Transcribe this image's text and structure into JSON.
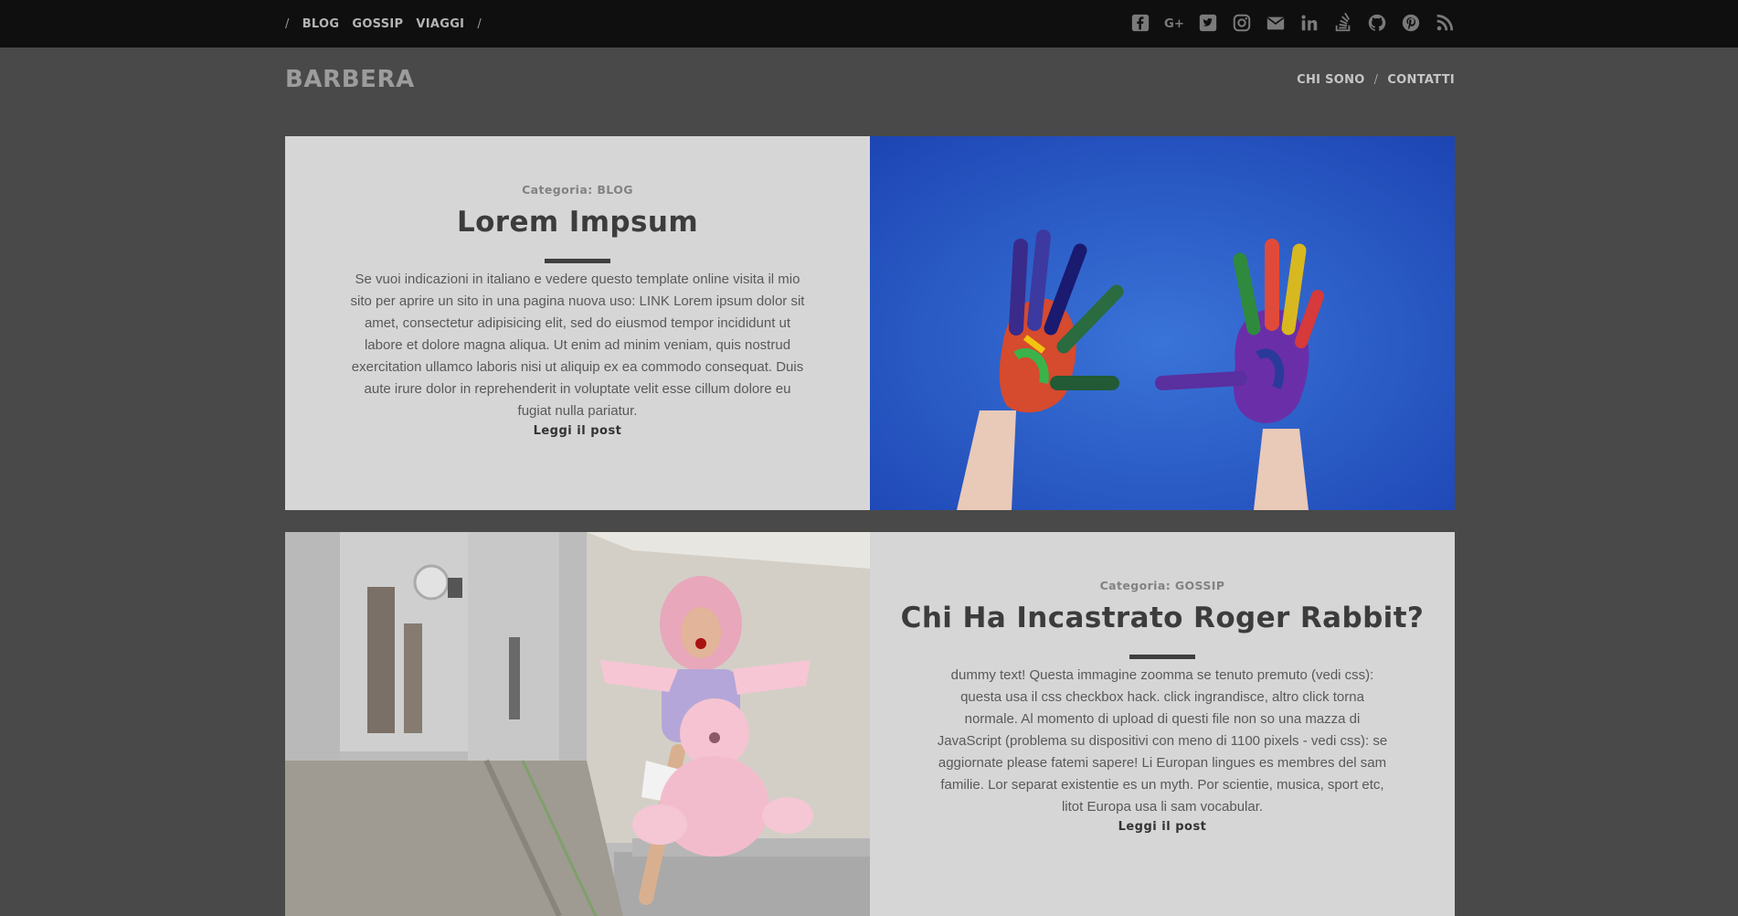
{
  "topbar": {
    "links": [
      "BLOG",
      "GOSSIP",
      "VIAGGI"
    ],
    "separator": "/",
    "social_icons": [
      "facebook-icon",
      "google-plus-icon",
      "twitter-icon",
      "instagram-icon",
      "mail-icon",
      "linkedin-icon",
      "stackoverflow-icon",
      "github-icon",
      "pinterest-icon",
      "rss-icon"
    ]
  },
  "header": {
    "brand": "BARBERA",
    "nav": [
      "CHI SONO",
      "CONTATTI"
    ],
    "separator": "/"
  },
  "posts": [
    {
      "category": "Categoria: BLOG",
      "title": "Lorem Impsum",
      "excerpt": "Se vuoi indicazioni in italiano e vedere questo template online visita il mio sito per aprire un sito in una pagina nuova uso: LINK Lorem ipsum dolor sit amet, consectetur adipisicing elit, sed do eiusmod tempor incididunt ut labore et dolore magna aliqua. Ut enim ad minim veniam, quis nostrud exercitation ullamco laboris nisi ut aliquip ex ea commodo consequat. Duis aute irure dolor in reprehenderit in voluptate velit esse cillum dolore eu fugiat nulla pariatur.",
      "read_more": "Leggi il post"
    },
    {
      "category": "Categoria: GOSSIP",
      "title": "Chi Ha Incastrato Roger Rabbit?",
      "excerpt": "dummy text! Questa immagine zoomma se tenuto premuto (vedi css): questa usa il css checkbox hack. click ingrandisce, altro click torna normale. Al momento di upload di questi file non so una mazza di JavaScript (problema su dispositivi con meno di 1100 pixels - vedi css): se aggiornate please fatemi sapere! Li Europan lingues es membres del sam familie. Lor separat existentie es un myth. Por scientie, musica, sport etc, litot Europa usa li sam vocabular.",
      "read_more": "Leggi il post"
    }
  ],
  "colors": {
    "page_bg": "#494949",
    "topbar_bg": "#0f0f0f",
    "card_bg": "#d6d6d6",
    "sky_blue": "#2f5fc4"
  }
}
